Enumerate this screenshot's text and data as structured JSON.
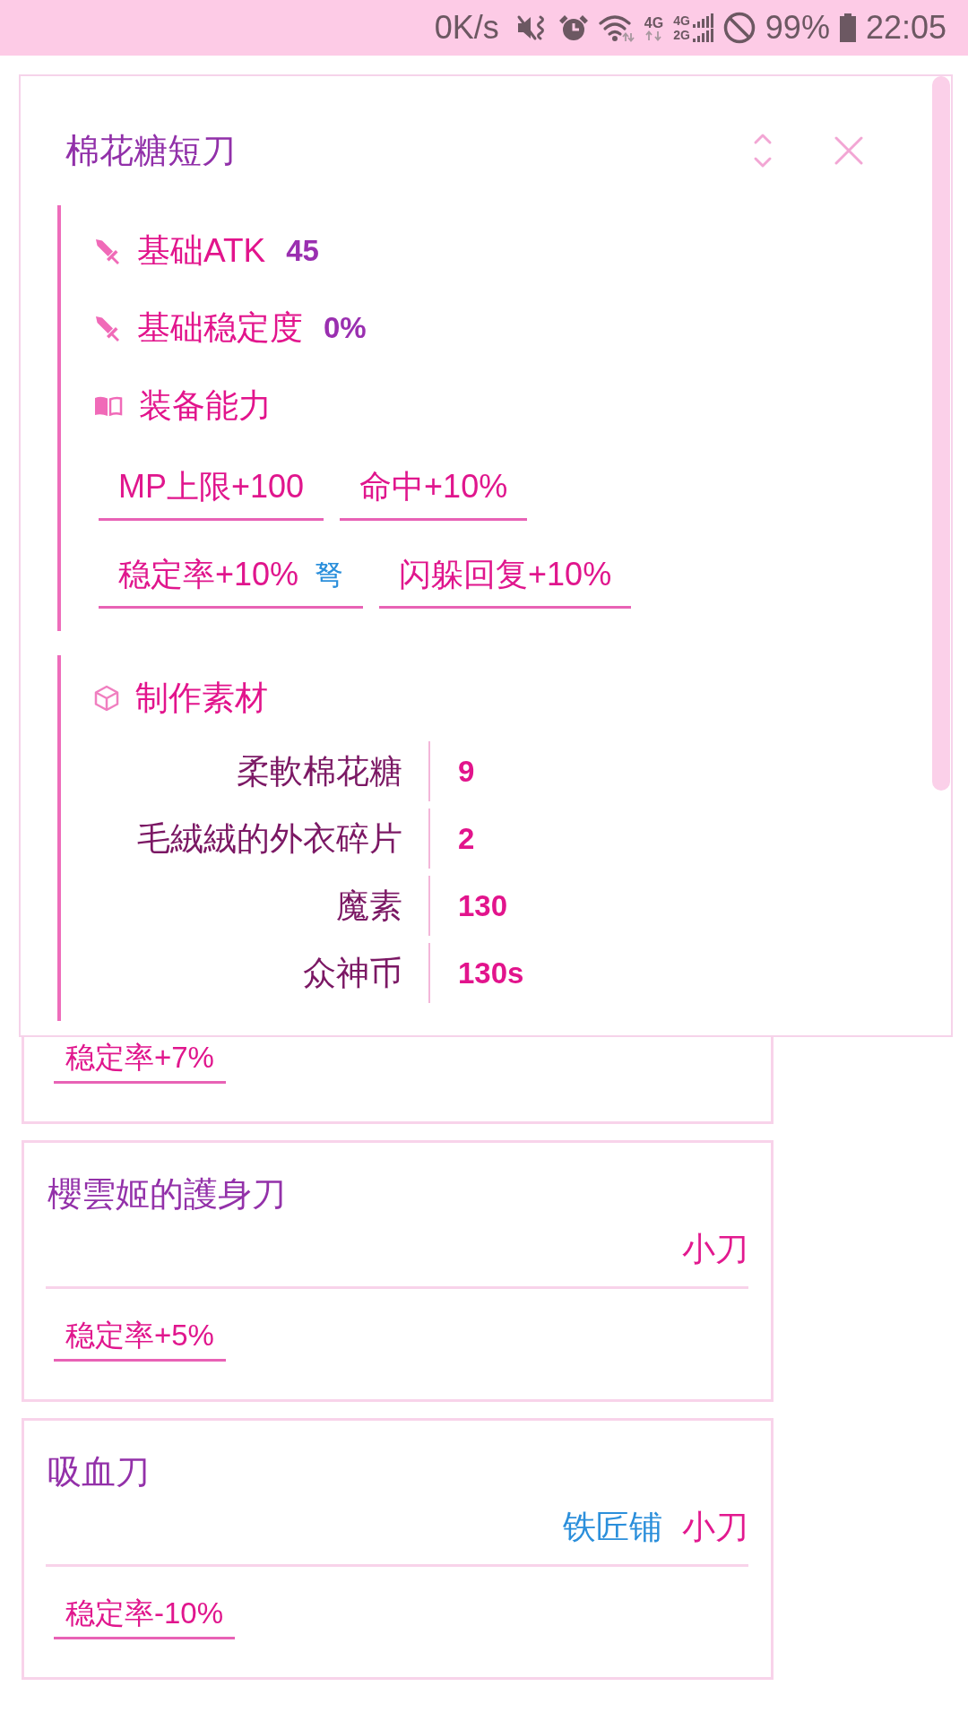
{
  "status_bar": {
    "net_speed": "0K/s",
    "data_network": "4G",
    "sim_networks": [
      "4G",
      "2G"
    ],
    "battery": "99%",
    "time": "22:05"
  },
  "popup": {
    "title": "棉花糖短刀",
    "stats": [
      {
        "label": "基础ATK",
        "value": "45"
      },
      {
        "label": "基础稳定度",
        "value": "0%"
      }
    ],
    "abilities": {
      "heading": "装备能力",
      "tags": [
        {
          "text": "MP上限+100"
        },
        {
          "text": "命中+10%"
        },
        {
          "text": "稳定率+10%",
          "weapon": "弩"
        },
        {
          "text": "闪躲回复+10%"
        }
      ]
    },
    "materials": {
      "heading": "制作素材",
      "rows": [
        {
          "name": "柔軟棉花糖",
          "amount": "9"
        },
        {
          "name": "毛絨絨的外衣碎片",
          "amount": "2"
        },
        {
          "name": "魔素",
          "amount": "130"
        },
        {
          "name": "众神币",
          "amount": "130s"
        }
      ]
    }
  },
  "cards": [
    {
      "tags": [
        "稳定率+7%"
      ]
    },
    {
      "title": "櫻雲姬的護身刀",
      "type": "小刀",
      "tags": [
        "稳定率+5%"
      ]
    },
    {
      "title": "吸血刀",
      "source": "铁匠铺",
      "type": "小刀",
      "tags": [
        "稳定率-10%"
      ]
    }
  ]
}
